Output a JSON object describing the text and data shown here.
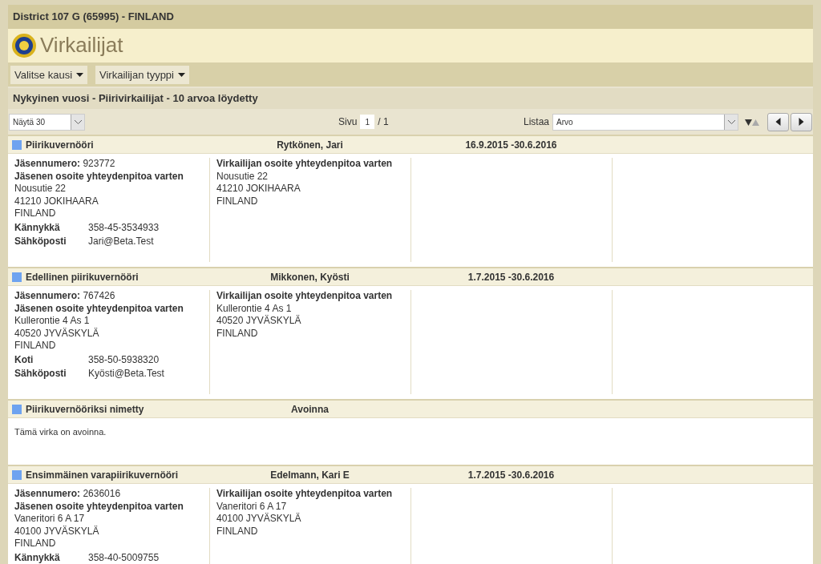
{
  "district": "District 107 G (65995) - FINLAND",
  "page_title": "Virkailijat",
  "menus": [
    {
      "label": "Valitse kausi"
    },
    {
      "label": "Virkailijan tyyppi"
    }
  ],
  "summary": "Nykyinen vuosi - Piirivirkailijat - 10 arvoa löydetty",
  "toolbar": {
    "page_size": "Näytä 30",
    "page_label": "Sivu",
    "page_value": "1",
    "page_total": "/ 1",
    "sort_label": "Listaa",
    "sort_value": "Arvo"
  },
  "officers": [
    {
      "kind": "filled",
      "role": "Piirikuvernööri",
      "name": "Rytkönen, Jari",
      "period": "16.9.2015 -30.6.2016",
      "member_number_label": "Jäsennumero:",
      "member_number": "923772",
      "member_address_label": "Jäsenen osoite yhteydenpitoa varten",
      "member_address": [
        "Nousutie 22",
        "41210 JOKIHAARA",
        "FINLAND"
      ],
      "contacts": [
        {
          "label": "Kännykkä",
          "value": "358-45-3534933"
        },
        {
          "label": "Sähköposti",
          "value": "Jari@Beta.Test"
        }
      ],
      "officer_address_label": "Virkailijan osoite yhteydenpitoa varten",
      "officer_address": [
        "Nousutie 22",
        "41210 JOKIHAARA",
        "FINLAND"
      ]
    },
    {
      "kind": "filled",
      "role": "Edellinen piirikuvernööri",
      "name": "Mikkonen, Kyösti",
      "period": "1.7.2015 -30.6.2016",
      "member_number_label": "Jäsennumero:",
      "member_number": "767426",
      "member_address_label": "Jäsenen osoite yhteydenpitoa varten",
      "member_address": [
        "Kullerontie 4 As 1",
        "40520 JYVÄSKYLÄ",
        "FINLAND"
      ],
      "contacts": [
        {
          "label": "Koti",
          "value": "358-50-5938320"
        },
        {
          "label": "Sähköposti",
          "value": "Kyösti@Beta.Test"
        }
      ],
      "officer_address_label": "Virkailijan osoite yhteydenpitoa varten",
      "officer_address": [
        "Kullerontie 4 As 1",
        "40520 JYVÄSKYLÄ",
        "FINLAND"
      ]
    },
    {
      "kind": "vacant",
      "role": "Piirikuvernööriksi nimetty",
      "name": "Avoinna",
      "vacant_text": "Tämä virka on avoinna."
    },
    {
      "kind": "filled",
      "role": "Ensimmäinen varapiirikuvernööri",
      "name": "Edelmann, Kari E",
      "period": "1.7.2015 -30.6.2016",
      "member_number_label": "Jäsennumero:",
      "member_number": "2636016",
      "member_address_label": "Jäsenen osoite yhteydenpitoa varten",
      "member_address": [
        "Vaneritori 6 A 17",
        "40100 JYVÄSKYLÄ",
        "FINLAND"
      ],
      "contacts": [
        {
          "label": "Kännykkä",
          "value": "358-40-5009755"
        }
      ],
      "officer_address_label": "Virkailijan osoite yhteydenpitoa varten",
      "officer_address": [
        "Vaneritori 6 A 17",
        "40100 JYVÄSKYLÄ",
        "FINLAND"
      ]
    }
  ]
}
